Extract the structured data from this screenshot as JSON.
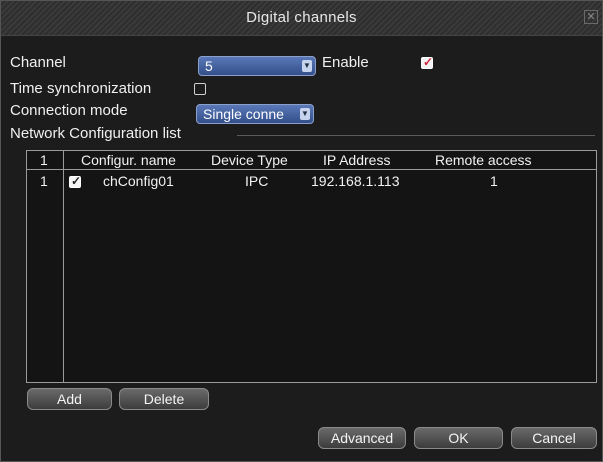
{
  "window": {
    "title": "Digital channels"
  },
  "form": {
    "channel_label": "Channel",
    "channel_value": "5",
    "enable_label": "Enable",
    "time_sync_label": "Time synchronization",
    "connection_mode_label": "Connection mode",
    "connection_mode_value": "Single conne",
    "network_list_label": "Network Configuration list"
  },
  "table": {
    "headers": [
      "1",
      "Configur. name",
      "Device Type",
      "IP Address",
      "Remote access"
    ],
    "rows": [
      {
        "index": "1",
        "checked": true,
        "name": "chConfig01",
        "device_type": "IPC",
        "ip": "192.168.1.113",
        "remote": "1"
      }
    ]
  },
  "buttons": {
    "add": "Add",
    "delete": "Delete",
    "advanced": "Advanced",
    "ok": "OK",
    "cancel": "Cancel"
  },
  "colors": {
    "background": "#1c1c1c",
    "combo_blue": "#3d5a99",
    "check_red": "#d2233c"
  }
}
